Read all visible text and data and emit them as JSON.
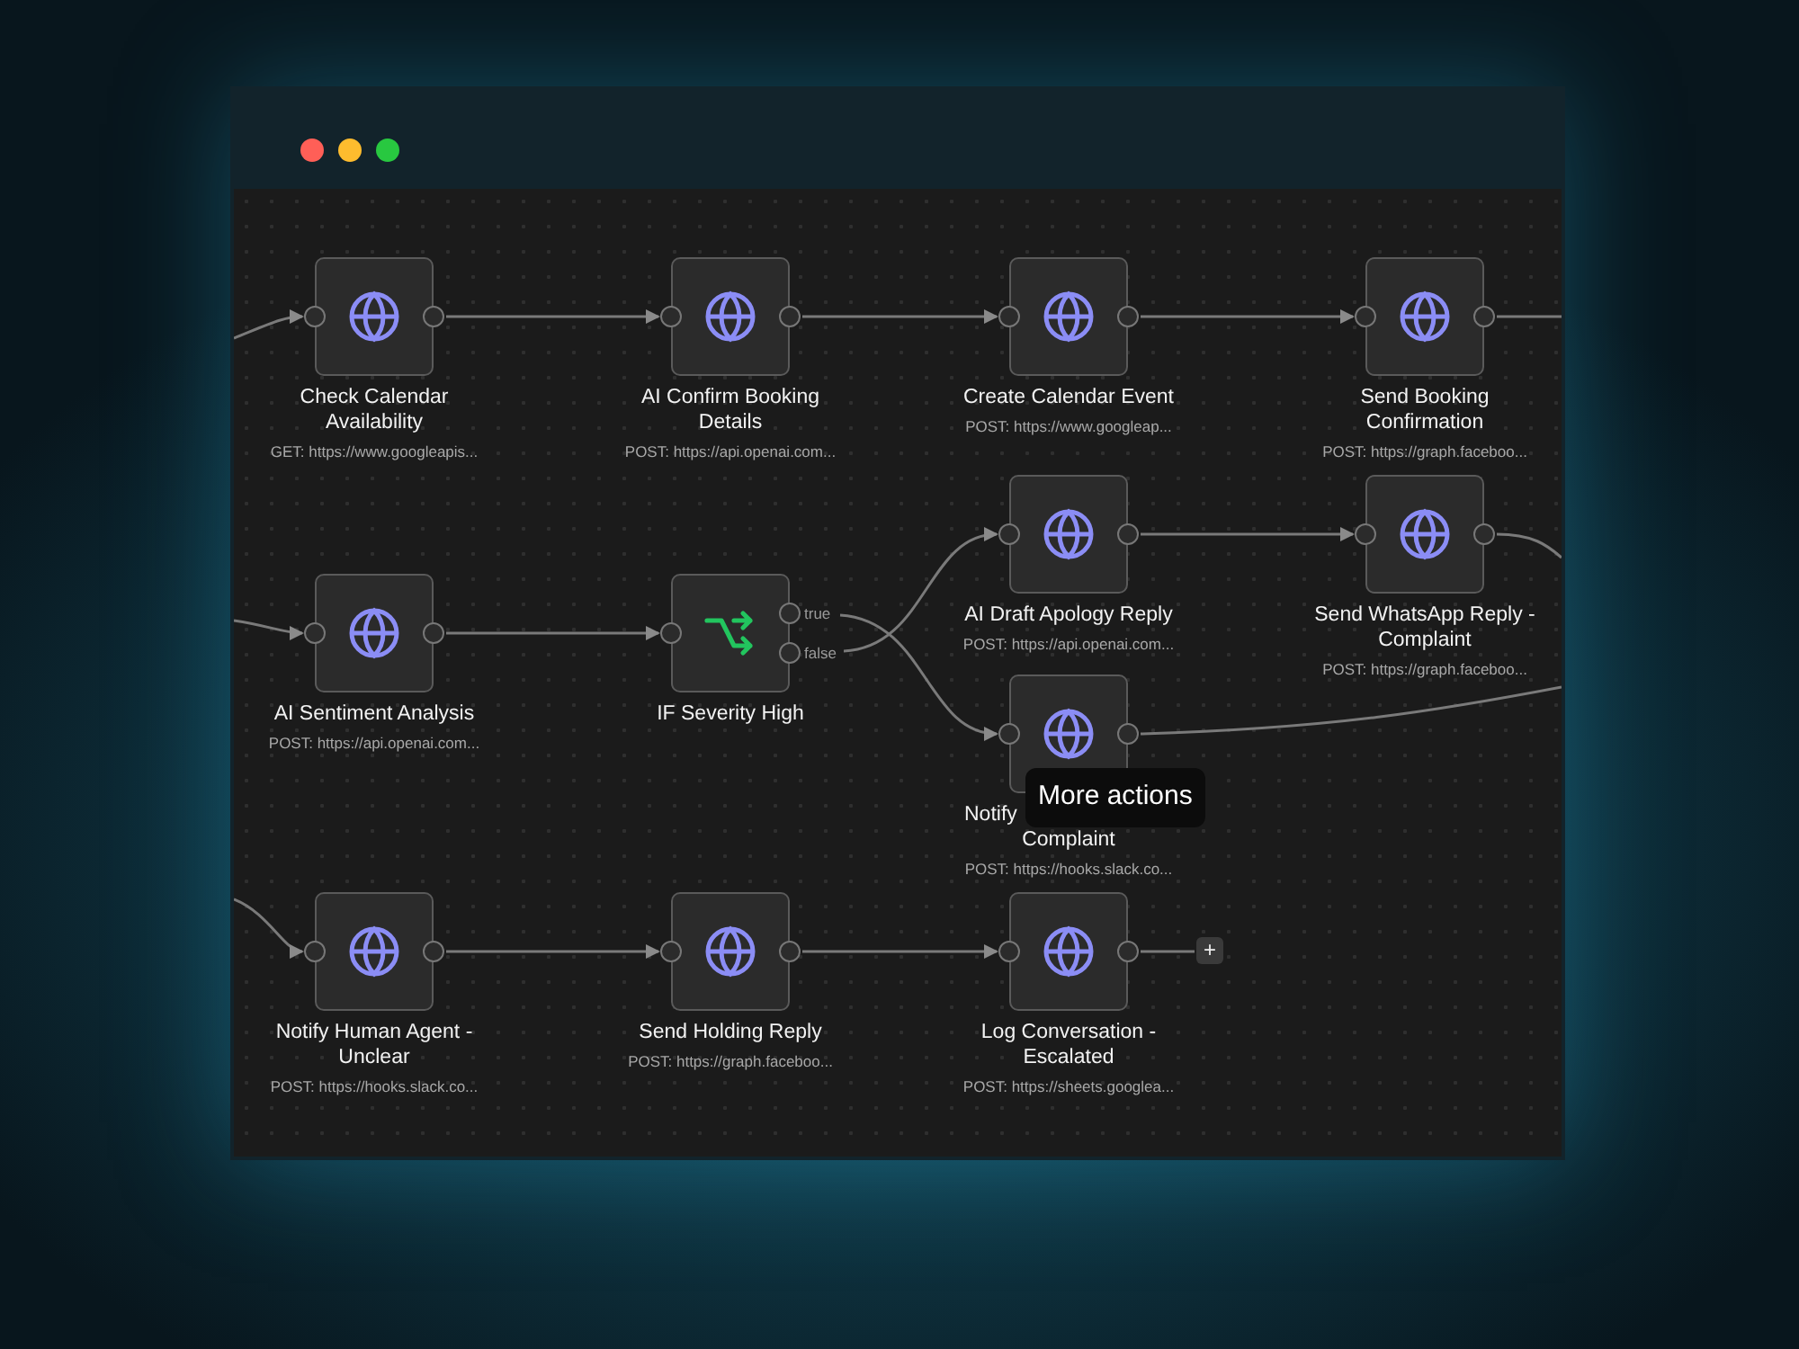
{
  "window": {
    "controls": [
      {
        "color": "#ff5f57"
      },
      {
        "color": "#febc2e"
      },
      {
        "color": "#28c840"
      }
    ]
  },
  "nodes": [
    {
      "kind": "http",
      "title": [
        "Check Calendar",
        "Availability"
      ],
      "subtitle": "GET: https://www.googleapis..."
    },
    {
      "kind": "http",
      "title": [
        "AI Confirm Booking",
        "Details"
      ],
      "subtitle": "POST: https://api.openai.com..."
    },
    {
      "kind": "http",
      "title": [
        "Create Calendar Event"
      ],
      "subtitle": "POST: https://www.googleap..."
    },
    {
      "kind": "http",
      "title": [
        "Send Booking",
        "Confirmation"
      ],
      "subtitle": "POST: https://graph.faceboo..."
    },
    {
      "kind": "http",
      "title": [
        "AI Sentiment Analysis"
      ],
      "subtitle": "POST: https://api.openai.com..."
    },
    {
      "kind": "if",
      "title": [
        "IF Severity High"
      ],
      "outputs": [
        "true",
        "false"
      ]
    },
    {
      "kind": "http",
      "title": [
        "AI Draft Apology Reply"
      ],
      "subtitle": "POST: https://api.openai.com..."
    },
    {
      "kind": "http",
      "title": [
        "Send WhatsApp Reply -",
        "Complaint"
      ],
      "subtitle": "POST: https://graph.faceboo..."
    },
    {
      "kind": "http",
      "title": [
        "Notify",
        "Complaint"
      ],
      "subtitle": "POST: https://hooks.slack.co..."
    },
    {
      "kind": "http",
      "title": [
        "Notify Human Agent -",
        "Unclear"
      ],
      "subtitle": "POST: https://hooks.slack.co..."
    },
    {
      "kind": "http",
      "title": [
        "Send Holding Reply"
      ],
      "subtitle": "POST: https://graph.faceboo..."
    },
    {
      "kind": "http",
      "title": [
        "Log Conversation -",
        "Escalated"
      ],
      "subtitle": "POST: https://sheets.googlea..."
    }
  ],
  "add_button": {
    "label": "+"
  },
  "tooltip": {
    "text": "More actions"
  }
}
